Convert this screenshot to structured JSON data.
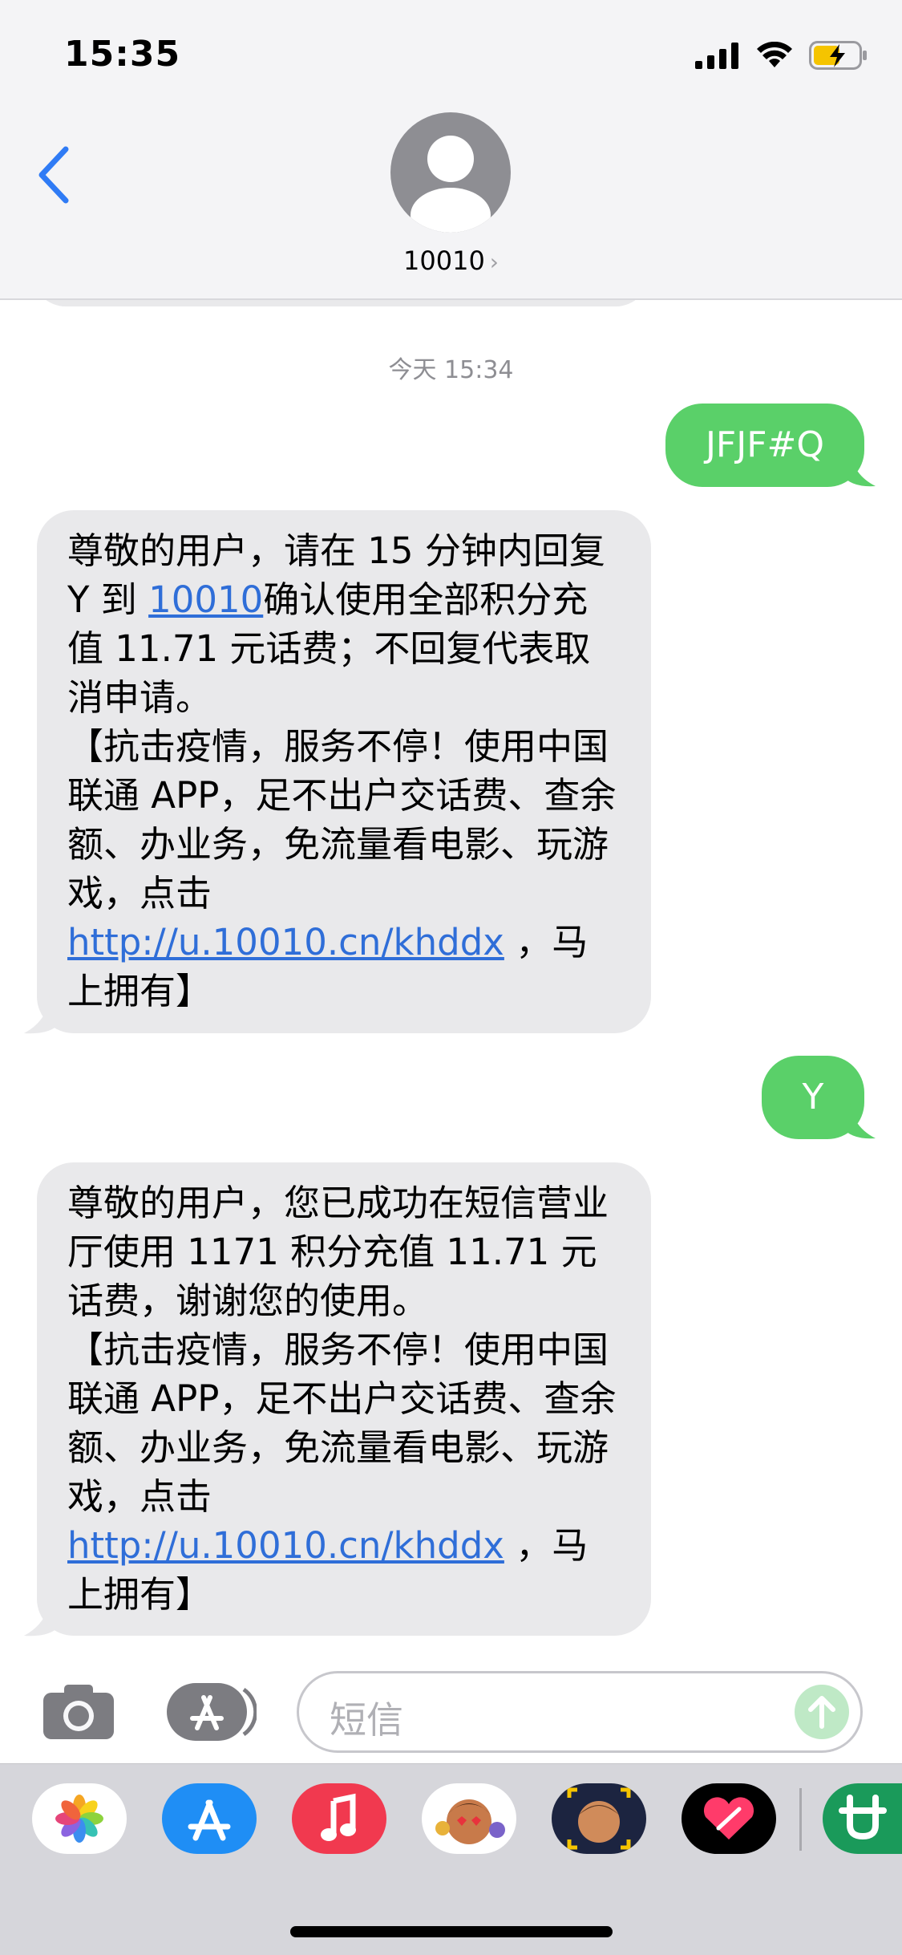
{
  "status_bar": {
    "time": "15:35"
  },
  "contact": {
    "name": "10010",
    "chevron": "›"
  },
  "thread": {
    "timestamp": "今天 15:34",
    "messages": [
      {
        "direction": "outgoing",
        "text": "JFJF#Q"
      },
      {
        "direction": "incoming",
        "text_before_link1": "尊敬的用户，请在 15 分钟内回复 Y 到 ",
        "link1": "10010",
        "text_after_link1": "确认使用全部积分充值 11.71 元话费；不回复代表取消申请。\n【抗击疫情，服务不停！使用中国联通 APP，足不出户交话费、查余额、办业务，免流量看电影、玩游戏，点击 ",
        "link2": "http://u.10010.cn/khddx",
        "text_after_link2": " ，马上拥有】"
      },
      {
        "direction": "outgoing",
        "text": "Y"
      },
      {
        "direction": "incoming",
        "text_before_link": "尊敬的用户，您已成功在短信营业厅使用 1171 积分充值 11.71 元话费，谢谢您的使用。\n【抗击疫情，服务不停！使用中国联通 APP，足不出户交话费、查余额、办业务，免流量看电影、玩游戏，点击 ",
        "link": "http://u.10010.cn/khddx",
        "text_after_link": " ，马上拥有】"
      }
    ]
  },
  "composer": {
    "placeholder": "短信"
  },
  "app_drawer": {
    "apps": [
      "photos-icon",
      "app-store-icon",
      "music-icon",
      "memoji-stickers-icon",
      "memoji-camera-icon",
      "digital-touch-icon",
      "extension-app-icon"
    ]
  },
  "colors": {
    "outgoing_bubble": "#5ad069",
    "incoming_bubble": "#e9e9eb",
    "link": "#2f6ed8",
    "back_chevron": "#2f7bf5"
  }
}
